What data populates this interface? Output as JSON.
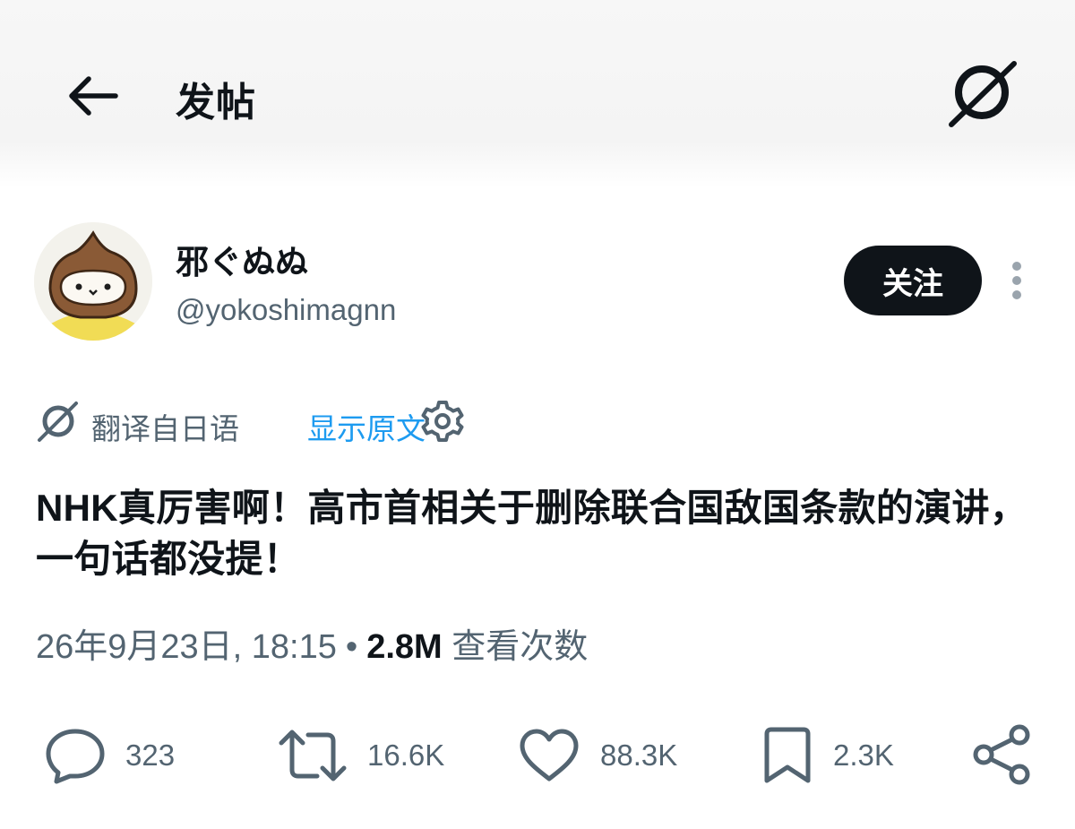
{
  "header": {
    "title": "发帖",
    "back_icon": "arrow-left-icon",
    "grok_icon": "grok-icon"
  },
  "author": {
    "display_name": "邪ぐぬぬ",
    "handle": "@yokoshimagnn",
    "avatar_icon": "chestnut-avatar"
  },
  "actions_top": {
    "follow_label": "关注",
    "more_icon": "more-vertical-icon"
  },
  "translation": {
    "icon": "grok-translate-icon",
    "label": "翻译自日语",
    "show_original": "显示原文",
    "settings_icon": "gear-icon"
  },
  "tweet": {
    "text": "NHK真厉害啊！高市首相关于删除联合国敌国条款的演讲，一句话都没提！",
    "timestamp": "26年9月23日, 18:15",
    "separator": "•",
    "views_count": "2.8M",
    "views_label": "查看次数"
  },
  "stats": {
    "replies": "323",
    "reposts": "16.6K",
    "likes": "88.3K",
    "bookmarks": "2.3K"
  },
  "colors": {
    "text": "#0f1419",
    "secondary": "#536471",
    "link": "#1d9bf0",
    "follow_bg": "#0f1419"
  }
}
